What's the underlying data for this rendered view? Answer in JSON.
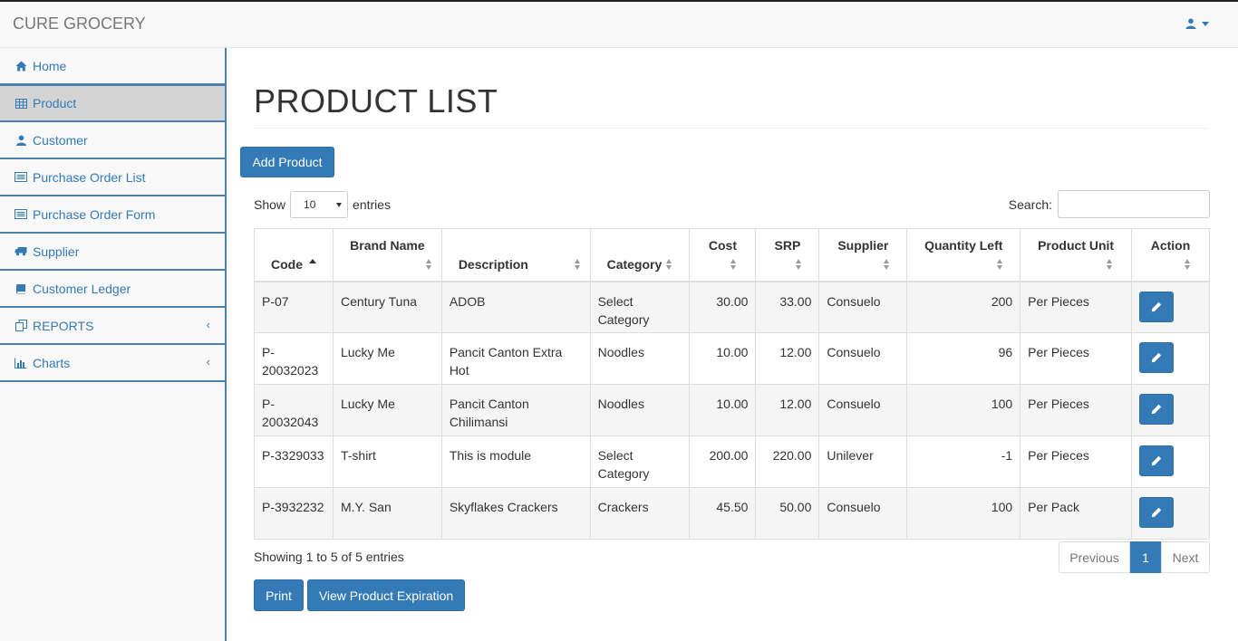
{
  "header": {
    "brand": "CURE GROCERY",
    "user_icon": "user-icon"
  },
  "sidebar": {
    "items": [
      {
        "label": "Home",
        "icon": "home-icon"
      },
      {
        "label": "Product",
        "icon": "table-icon"
      },
      {
        "label": "Customer",
        "icon": "user-icon"
      },
      {
        "label": "Purchase Order List",
        "icon": "list-icon"
      },
      {
        "label": "Purchase Order Form",
        "icon": "list-icon"
      },
      {
        "label": "Supplier",
        "icon": "truck-icon"
      },
      {
        "label": "Customer Ledger",
        "icon": "book-icon"
      },
      {
        "label": "REPORTS",
        "icon": "copy-icon",
        "chevron": "‹"
      },
      {
        "label": "Charts",
        "icon": "bar-chart-icon",
        "chevron": "‹"
      }
    ]
  },
  "main": {
    "title": "PRODUCT LIST",
    "add_button": "Add Product",
    "show_label": "Show",
    "entries_label": "entries",
    "page_length": "10",
    "search_label": "Search:",
    "search_value": "",
    "columns": [
      "Code",
      "Brand Name",
      "Description",
      "Category",
      "Cost",
      "SRP",
      "Supplier",
      "Quantity Left",
      "Product Unit",
      "Action"
    ],
    "rows": [
      {
        "code": "P-07",
        "brand": "Century Tuna",
        "description": "ADOB",
        "category": "Select Category",
        "cost": "30.00",
        "srp": "33.00",
        "supplier": "Consuelo",
        "qty": "200",
        "unit": "Per Pieces"
      },
      {
        "code": "P-20032023",
        "brand": "Lucky Me",
        "description": "Pancit Canton Extra Hot",
        "category": "Noodles",
        "cost": "10.00",
        "srp": "12.00",
        "supplier": "Consuelo",
        "qty": "96",
        "unit": "Per Pieces"
      },
      {
        "code": "P-20032043",
        "brand": "Lucky Me",
        "description": "Pancit Canton Chilimansi",
        "category": "Noodles",
        "cost": "10.00",
        "srp": "12.00",
        "supplier": "Consuelo",
        "qty": "100",
        "unit": "Per Pieces"
      },
      {
        "code": "P-3329033",
        "brand": "T-shirt",
        "description": "This is module",
        "category": "Select Category",
        "cost": "200.00",
        "srp": "220.00",
        "supplier": "Unilever",
        "qty": "-1",
        "unit": "Per Pieces"
      },
      {
        "code": "P-3932232",
        "brand": "M.Y. San",
        "description": "Skyflakes Crackers",
        "category": "Crackers",
        "cost": "45.50",
        "srp": "50.00",
        "supplier": "Consuelo",
        "qty": "100",
        "unit": "Per Pack"
      }
    ],
    "info": "Showing 1 to 5 of 5 entries",
    "pager": {
      "prev": "Previous",
      "current": "1",
      "next": "Next"
    },
    "print_button": "Print",
    "expiration_button": "View Product Expiration"
  },
  "colors": {
    "primary": "#337ab7",
    "sidebar_border": "#4a7fb0",
    "active_bg": "#d4d4d4"
  }
}
